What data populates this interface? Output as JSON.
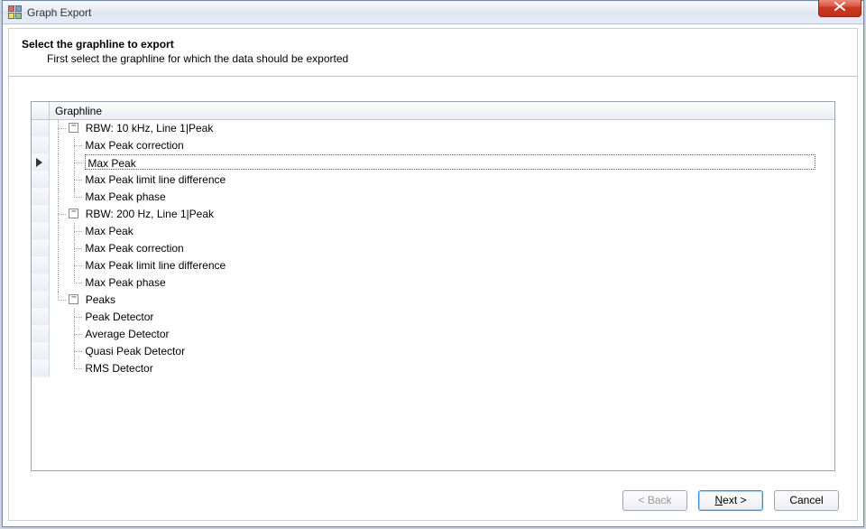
{
  "window": {
    "title": "Graph Export"
  },
  "header": {
    "heading": "Select the graphline to export",
    "subheading": "First select the graphline for which the data should be exported"
  },
  "column_header": "Graphline",
  "tree": [
    {
      "label": "RBW: 10 kHz, Line 1|Peak",
      "children": [
        {
          "label": "Max Peak correction"
        },
        {
          "label": "Max Peak",
          "selected": true
        },
        {
          "label": "Max Peak limit line difference"
        },
        {
          "label": "Max Peak phase"
        }
      ]
    },
    {
      "label": "RBW: 200 Hz, Line 1|Peak",
      "children": [
        {
          "label": "Max Peak"
        },
        {
          "label": "Max Peak correction"
        },
        {
          "label": "Max Peak limit line difference"
        },
        {
          "label": "Max Peak phase"
        }
      ]
    },
    {
      "label": "Peaks",
      "children": [
        {
          "label": "Peak Detector"
        },
        {
          "label": "Average Detector"
        },
        {
          "label": "Quasi Peak Detector"
        },
        {
          "label": "RMS Detector"
        }
      ]
    }
  ],
  "buttons": {
    "back": "< Back",
    "next_prefix": "N",
    "next_rest": "ext >",
    "cancel": "Cancel"
  }
}
